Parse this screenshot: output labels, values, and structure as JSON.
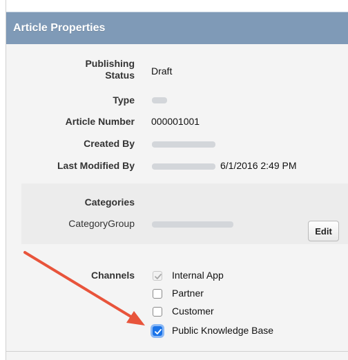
{
  "panel": {
    "title": "Article Properties"
  },
  "fields": {
    "publishing_status": {
      "label_line1": "Publishing",
      "label_line2": "Status",
      "value": "Draft"
    },
    "type": {
      "label": "Type"
    },
    "article_number": {
      "label": "Article Number",
      "value": "000001001"
    },
    "created_by": {
      "label": "Created By"
    },
    "last_modified_by": {
      "label": "Last Modified By",
      "date": "6/1/2016 2:49 PM"
    }
  },
  "categories": {
    "heading": "Categories",
    "group_label": "CategoryGroup",
    "edit_label": "Edit"
  },
  "channels": {
    "label": "Channels",
    "items": [
      {
        "label": "Internal App",
        "checked": true,
        "disabled": true
      },
      {
        "label": "Partner",
        "checked": false,
        "disabled": false
      },
      {
        "label": "Customer",
        "checked": false,
        "disabled": false
      },
      {
        "label": "Public Knowledge Base",
        "checked": true,
        "disabled": false
      }
    ]
  },
  "colors": {
    "header_bg": "#7f9ab7",
    "checkbox_checked": "#1a73e8",
    "annotation_arrow": "#e8543b"
  },
  "icons": {
    "check": "check-icon",
    "arrow": "annotation-arrow-icon"
  }
}
